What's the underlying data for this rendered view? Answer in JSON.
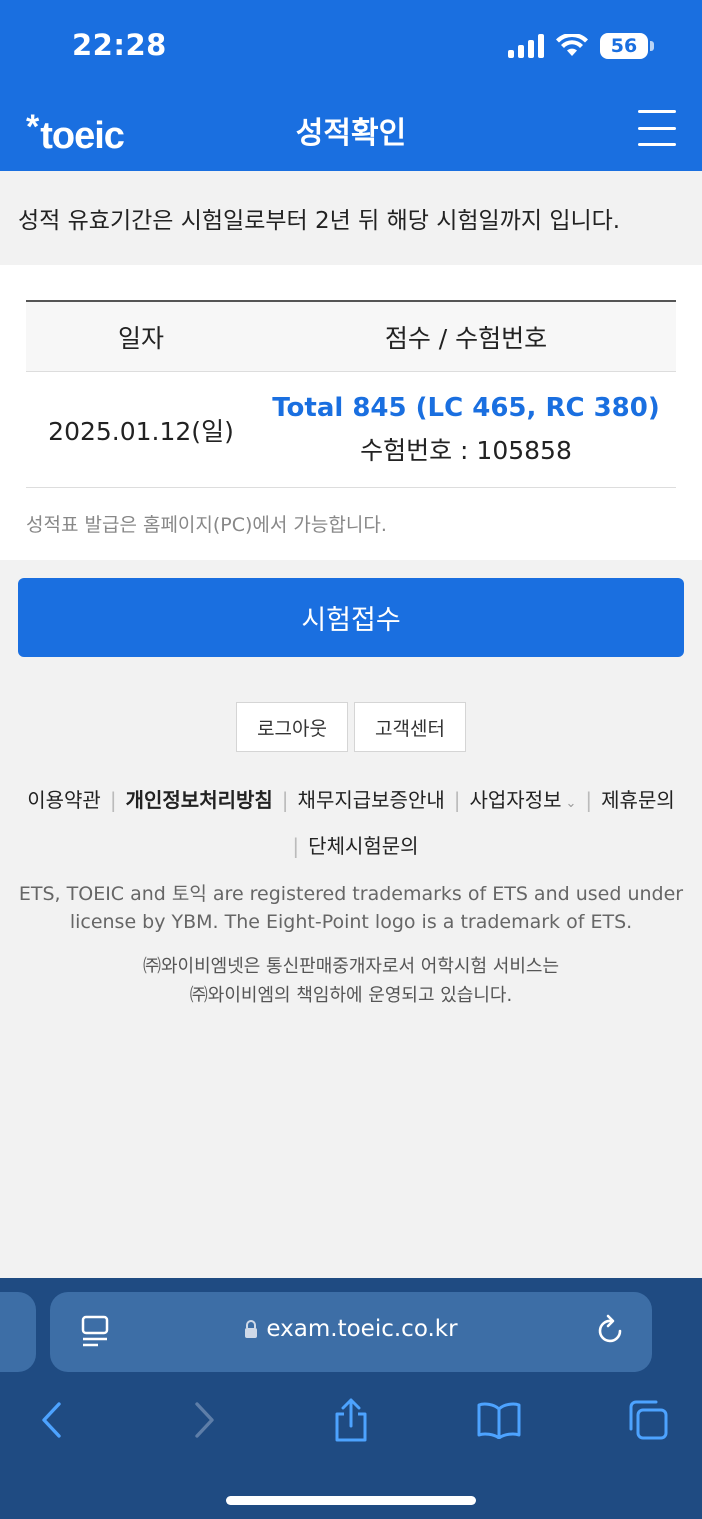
{
  "status_bar": {
    "time": "22:28",
    "battery": "56"
  },
  "header": {
    "logo": "toeic",
    "logo_mark": "*",
    "title": "성적확인"
  },
  "notice": "성적 유효기간은 시험일로부터 2년 뒤 해당 시험일까지 입니다.",
  "table": {
    "headers": [
      "일자",
      "점수 / 수험번호"
    ],
    "rows": [
      {
        "date": "2025.01.12(일)",
        "total": "Total 845 (LC 465, RC 380)",
        "exam_no": "수험번호 : 105858"
      }
    ]
  },
  "card_note": "성적표 발급은 홈페이지(PC)에서 가능합니다.",
  "main_button": "시험접수",
  "small_buttons": [
    "로그아웃",
    "고객센터"
  ],
  "footer_links": [
    "이용약관",
    "개인정보처리방침",
    "채무지급보증안내",
    "사업자정보",
    "제휴문의",
    "단체시험문의"
  ],
  "footer_trademark": [
    "ETS, TOEIC and 토익 are registered trademarks of ETS and used under",
    "license by YBM. The Eight-Point logo is a trademark of ETS."
  ],
  "footer_company": [
    "㈜와이비엠넷은 통신판매중개자로서 어학시험 서비스는",
    "㈜와이비엠의 책임하에 운영되고 있습니다."
  ],
  "browser": {
    "url": "exam.toeic.co.kr"
  },
  "colors": {
    "brand": "#1a6fe0",
    "browser_bar": "#1f4b82"
  }
}
